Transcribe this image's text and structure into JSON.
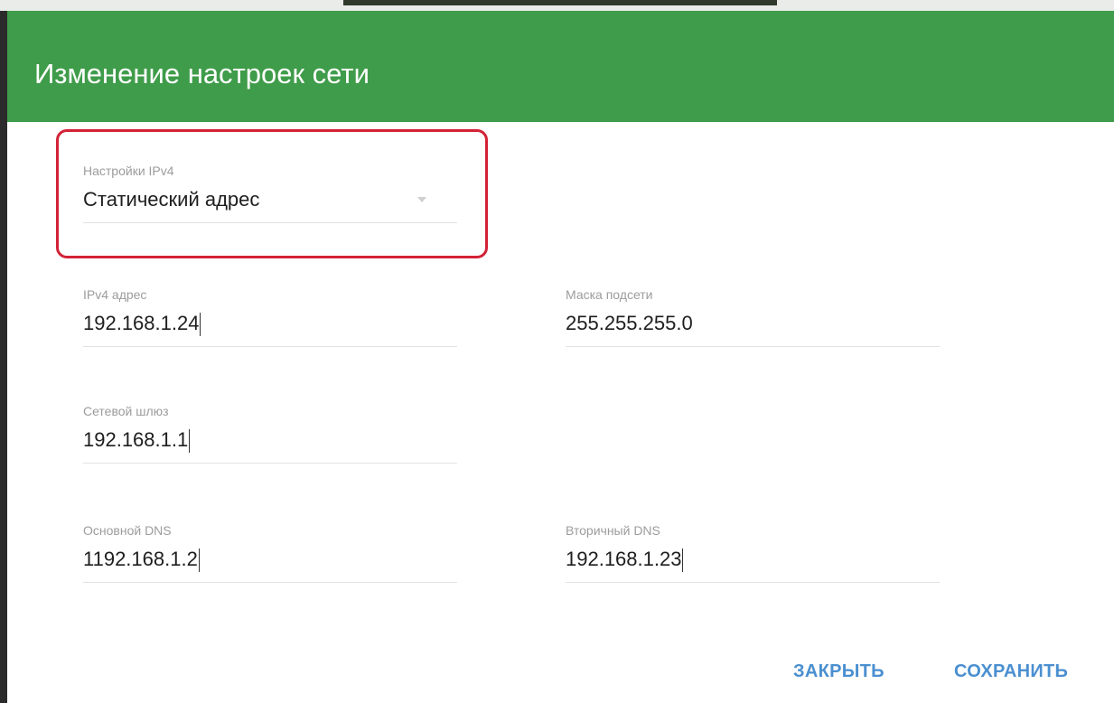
{
  "dialog": {
    "title": "Изменение настроек сети"
  },
  "ipv4_settings": {
    "label": "Настройки IPv4",
    "value": "Статический адрес",
    "highlighted": true,
    "highlight_color": "#d32236"
  },
  "fields": {
    "ipv4_address": {
      "label": "IPv4 адрес",
      "value": "192.168.1.24"
    },
    "subnet_mask": {
      "label": "Маска подсети",
      "value": "255.255.255.0"
    },
    "gateway": {
      "label": "Сетевой шлюз",
      "value": "192.168.1.1"
    },
    "primary_dns": {
      "label": "Основной DNS",
      "value": "1192.168.1.2"
    },
    "secondary_dns": {
      "label": "Вторичный DNS",
      "value": "192.168.1.23"
    }
  },
  "buttons": {
    "close": "ЗАКРЫТЬ",
    "save": "СОХРАНИТЬ"
  },
  "colors": {
    "header": "#3f9c4a",
    "button_text": "#4a8fd0",
    "highlight": "#d32236"
  },
  "icons": {
    "select_arrow": "chevron-down-icon"
  }
}
